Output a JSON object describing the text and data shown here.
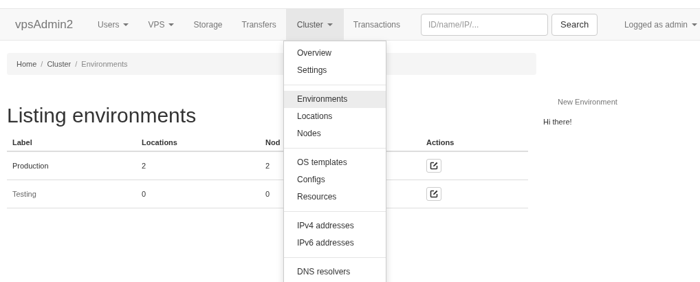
{
  "navbar": {
    "brand": "vpsAdmin2",
    "items": [
      {
        "label": "Users",
        "dropdown": true,
        "selected": false
      },
      {
        "label": "VPS",
        "dropdown": true,
        "selected": false
      },
      {
        "label": "Storage",
        "dropdown": false,
        "selected": false
      },
      {
        "label": "Transfers",
        "dropdown": false,
        "selected": false
      },
      {
        "label": "Cluster",
        "dropdown": true,
        "selected": true
      },
      {
        "label": "Transactions",
        "dropdown": false,
        "selected": false
      }
    ],
    "search": {
      "placeholder": "ID/name/IP/...",
      "button": "Search"
    },
    "user_menu": {
      "label": "Logged as admin",
      "dropdown": true
    }
  },
  "dropdown_menu": [
    [
      {
        "label": "Overview",
        "selected": false
      },
      {
        "label": "Settings",
        "selected": false
      }
    ],
    [
      {
        "label": "Environments",
        "selected": true
      },
      {
        "label": "Locations",
        "selected": false
      },
      {
        "label": "Nodes",
        "selected": false
      }
    ],
    [
      {
        "label": "OS templates",
        "selected": false
      },
      {
        "label": "Configs",
        "selected": false
      },
      {
        "label": "Resources",
        "selected": false
      }
    ],
    [
      {
        "label": "IPv4 addresses",
        "selected": false
      },
      {
        "label": "IPv6 addresses",
        "selected": false
      }
    ],
    [
      {
        "label": "DNS resolvers",
        "selected": false
      }
    ]
  ],
  "breadcrumb": [
    {
      "label": "Home"
    },
    {
      "label": "Cluster",
      "separator": "/"
    },
    {
      "label": "Environments",
      "separator": "/"
    }
  ],
  "title": "Listing environments",
  "table": {
    "columns": [
      "Label",
      "Locations",
      "Nod",
      "Actions"
    ],
    "rows": [
      {
        "label": "Production",
        "locations": "2",
        "nodes": "2",
        "muted": false
      },
      {
        "label": "Testing",
        "locations": "0",
        "nodes": "0",
        "muted": true
      }
    ]
  },
  "sidebar": {
    "link": "New Environment",
    "text": "Hi there!"
  }
}
